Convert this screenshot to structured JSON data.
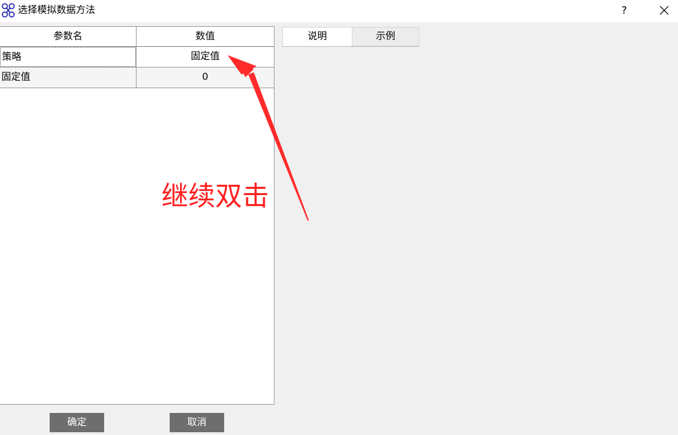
{
  "window": {
    "title": "选择模拟数据方法",
    "help_label": "?"
  },
  "table": {
    "headers": [
      "参数名",
      "数值"
    ],
    "rows": [
      {
        "name": "策略",
        "value": "固定值"
      },
      {
        "name": "固定值",
        "value": "0"
      }
    ]
  },
  "tabs": [
    {
      "label": "说明",
      "active": true
    },
    {
      "label": "示例",
      "active": false
    }
  ],
  "annotation": {
    "text": "继续双击",
    "color": "#ff1f1f"
  },
  "buttons": {
    "ok_label": "确定",
    "cancel_label": "取消"
  },
  "colors": {
    "button_bg": "#6e6e6e",
    "background": "#f0f0f0"
  }
}
